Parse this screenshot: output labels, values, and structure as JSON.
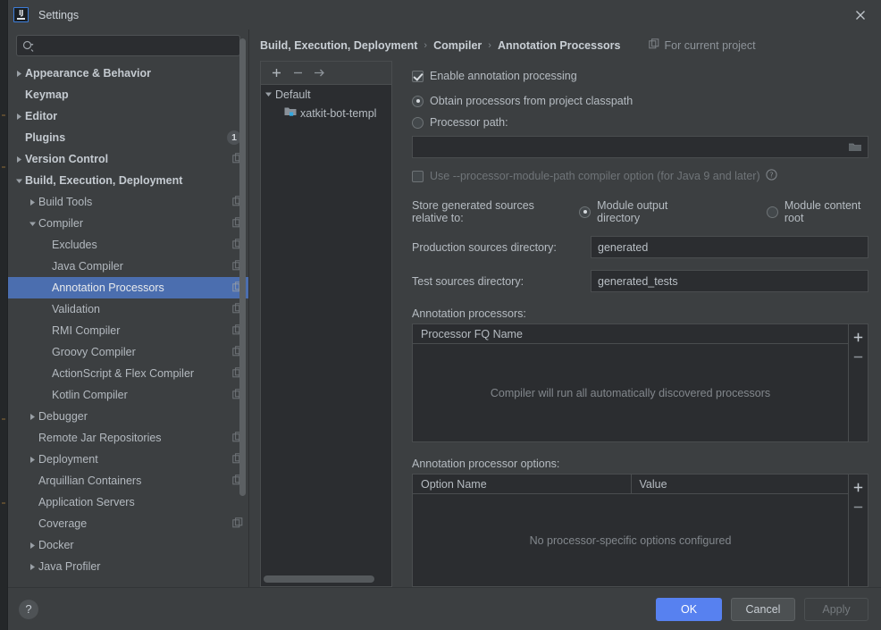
{
  "window": {
    "title": "Settings",
    "logo_text": "IJ",
    "close_icon": "close-icon"
  },
  "search": {
    "value": "",
    "placeholder": ""
  },
  "sidebar": {
    "items": [
      {
        "label": "Appearance & Behavior",
        "arrow": "collapsed",
        "indent": 0,
        "bold": true,
        "copy": false,
        "badge": "",
        "selected": false
      },
      {
        "label": "Keymap",
        "arrow": "none",
        "indent": 0,
        "bold": true,
        "copy": false,
        "badge": "",
        "selected": false
      },
      {
        "label": "Editor",
        "arrow": "collapsed",
        "indent": 0,
        "bold": true,
        "copy": false,
        "badge": "",
        "selected": false
      },
      {
        "label": "Plugins",
        "arrow": "none",
        "indent": 0,
        "bold": true,
        "copy": false,
        "badge": "1",
        "selected": false
      },
      {
        "label": "Version Control",
        "arrow": "collapsed",
        "indent": 0,
        "bold": true,
        "copy": true,
        "badge": "",
        "selected": false
      },
      {
        "label": "Build, Execution, Deployment",
        "arrow": "expanded",
        "indent": 0,
        "bold": true,
        "copy": false,
        "badge": "",
        "selected": false
      },
      {
        "label": "Build Tools",
        "arrow": "collapsed",
        "indent": 1,
        "bold": false,
        "copy": true,
        "badge": "",
        "selected": false
      },
      {
        "label": "Compiler",
        "arrow": "expanded",
        "indent": 1,
        "bold": false,
        "copy": true,
        "badge": "",
        "selected": false
      },
      {
        "label": "Excludes",
        "arrow": "none",
        "indent": 2,
        "bold": false,
        "copy": true,
        "badge": "",
        "selected": false
      },
      {
        "label": "Java Compiler",
        "arrow": "none",
        "indent": 2,
        "bold": false,
        "copy": true,
        "badge": "",
        "selected": false
      },
      {
        "label": "Annotation Processors",
        "arrow": "none",
        "indent": 2,
        "bold": false,
        "copy": true,
        "badge": "",
        "selected": true
      },
      {
        "label": "Validation",
        "arrow": "none",
        "indent": 2,
        "bold": false,
        "copy": true,
        "badge": "",
        "selected": false
      },
      {
        "label": "RMI Compiler",
        "arrow": "none",
        "indent": 2,
        "bold": false,
        "copy": true,
        "badge": "",
        "selected": false
      },
      {
        "label": "Groovy Compiler",
        "arrow": "none",
        "indent": 2,
        "bold": false,
        "copy": true,
        "badge": "",
        "selected": false
      },
      {
        "label": "ActionScript & Flex Compiler",
        "arrow": "none",
        "indent": 2,
        "bold": false,
        "copy": true,
        "badge": "",
        "selected": false
      },
      {
        "label": "Kotlin Compiler",
        "arrow": "none",
        "indent": 2,
        "bold": false,
        "copy": true,
        "badge": "",
        "selected": false
      },
      {
        "label": "Debugger",
        "arrow": "collapsed",
        "indent": 1,
        "bold": false,
        "copy": false,
        "badge": "",
        "selected": false
      },
      {
        "label": "Remote Jar Repositories",
        "arrow": "none",
        "indent": 1,
        "bold": false,
        "copy": true,
        "badge": "",
        "selected": false
      },
      {
        "label": "Deployment",
        "arrow": "collapsed",
        "indent": 1,
        "bold": false,
        "copy": true,
        "badge": "",
        "selected": false
      },
      {
        "label": "Arquillian Containers",
        "arrow": "none",
        "indent": 1,
        "bold": false,
        "copy": true,
        "badge": "",
        "selected": false
      },
      {
        "label": "Application Servers",
        "arrow": "none",
        "indent": 1,
        "bold": false,
        "copy": false,
        "badge": "",
        "selected": false
      },
      {
        "label": "Coverage",
        "arrow": "none",
        "indent": 1,
        "bold": false,
        "copy": true,
        "badge": "",
        "selected": false
      },
      {
        "label": "Docker",
        "arrow": "collapsed",
        "indent": 1,
        "bold": false,
        "copy": false,
        "badge": "",
        "selected": false
      },
      {
        "label": "Java Profiler",
        "arrow": "collapsed",
        "indent": 1,
        "bold": false,
        "copy": false,
        "badge": "",
        "selected": false
      }
    ]
  },
  "breadcrumb": {
    "items": [
      "Build, Execution, Deployment",
      "Compiler",
      "Annotation Processors"
    ],
    "separator": "›",
    "scope_label": "For current project"
  },
  "modules": {
    "toolbar": {
      "add": "+",
      "remove": "−",
      "move": "→"
    },
    "rows": [
      {
        "label": "Default",
        "arrow": "expanded",
        "child": false
      },
      {
        "label": "xatkit-bot-templ",
        "arrow": "none",
        "child": true
      }
    ]
  },
  "form": {
    "enable_annotation_processing": {
      "label": "Enable annotation processing",
      "checked": true
    },
    "processor_source": {
      "selected": "classpath",
      "options": [
        {
          "id": "classpath",
          "label": "Obtain processors from project classpath"
        },
        {
          "id": "path",
          "label": "Processor path:"
        }
      ]
    },
    "processor_path_field": {
      "value": "",
      "folder_icon": "folder-icon"
    },
    "module_path_option": {
      "label": "Use --processor-module-path compiler option (for Java 9 and later)",
      "checked": false,
      "help_icon": "help-icon"
    },
    "store_generated": {
      "label": "Store generated sources relative to:",
      "selected": "output",
      "options": [
        {
          "id": "output",
          "label": "Module output directory"
        },
        {
          "id": "content",
          "label": "Module content root"
        }
      ]
    },
    "production_sources": {
      "label": "Production sources directory:",
      "value": "generated"
    },
    "test_sources": {
      "label": "Test sources directory:",
      "value": "generated_tests"
    },
    "processors_table": {
      "title": "Annotation processors:",
      "columns": [
        "Processor FQ Name"
      ],
      "rows": [],
      "empty_text": "Compiler will run all automatically discovered processors",
      "add_label": "+",
      "remove_label": "−"
    },
    "options_table": {
      "title": "Annotation processor options:",
      "columns": [
        "Option Name",
        "Value"
      ],
      "rows": [],
      "empty_text": "No processor-specific options configured",
      "add_label": "+",
      "remove_label": "−"
    }
  },
  "footer": {
    "help": "?",
    "ok": "OK",
    "cancel": "Cancel",
    "apply": "Apply"
  },
  "colors": {
    "accent": "#5781f0",
    "selection": "#4b6eaf",
    "panel_bg": "#3c3f41",
    "field_bg": "#2b2d30"
  }
}
